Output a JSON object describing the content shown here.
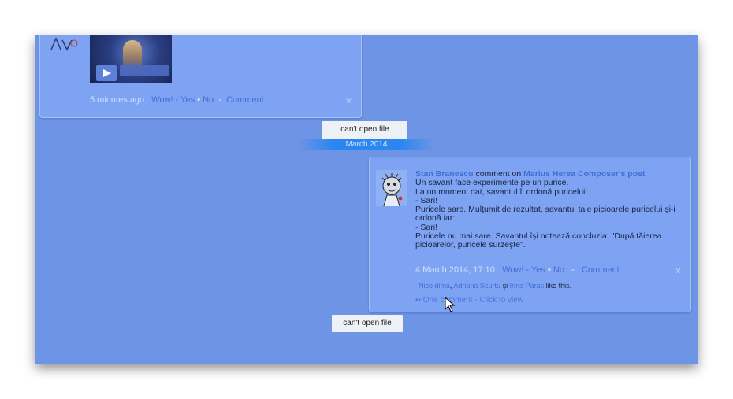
{
  "feed_top": {
    "video_post": {
      "time": "5 minutes ago",
      "wow_label": "Wow! - ",
      "yes_label": "Yes",
      "bullet": "•",
      "no_label": "No",
      "dash": "-",
      "comment_label": "Comment",
      "close_glyph": "×"
    }
  },
  "file_notices": {
    "first": "can't open file",
    "second": "can't open file"
  },
  "timeline_divider": {
    "label": "March 2014"
  },
  "comment_post": {
    "author": "Stan Branescu",
    "action": " comment on ",
    "target": "Marius Herea Composer",
    "target_suffix": "'s post",
    "lines": [
      "Un savant face experimente pe un purice.",
      "La un moment dat, savantul îi ordonă puricelui:",
      "- Sari!",
      "Puricele sare. Mulţumit de rezultat, savantul taie picioarele puricelui şi-i ordonă iar:",
      "- Sari!",
      "Puricele nu mai sare. Savantul îşi notează concluzia: \"După tăierea picioarelor, puricele surzeşte\"."
    ],
    "date": "4 March 2014, 17:10",
    "wow_label": "Wow! - ",
    "yes_label": "Yes",
    "bullet": "•",
    "no_label": "No",
    "dash": "-",
    "comment_label": "Comment",
    "close_glyph": "×",
    "likes": {
      "name1": "Nico dima",
      "comma": ", ",
      "name2": "Adriana Scurtu",
      "and": " şi ",
      "name3": "Irina Paras",
      "suffix": " like this."
    },
    "comments_toggle": "•• One comment - Click to view"
  },
  "colors": {
    "overlay": "#6e94e6",
    "card": "#7ea3f2",
    "link": "#3f6fd6",
    "divider": "#2c86ef"
  }
}
